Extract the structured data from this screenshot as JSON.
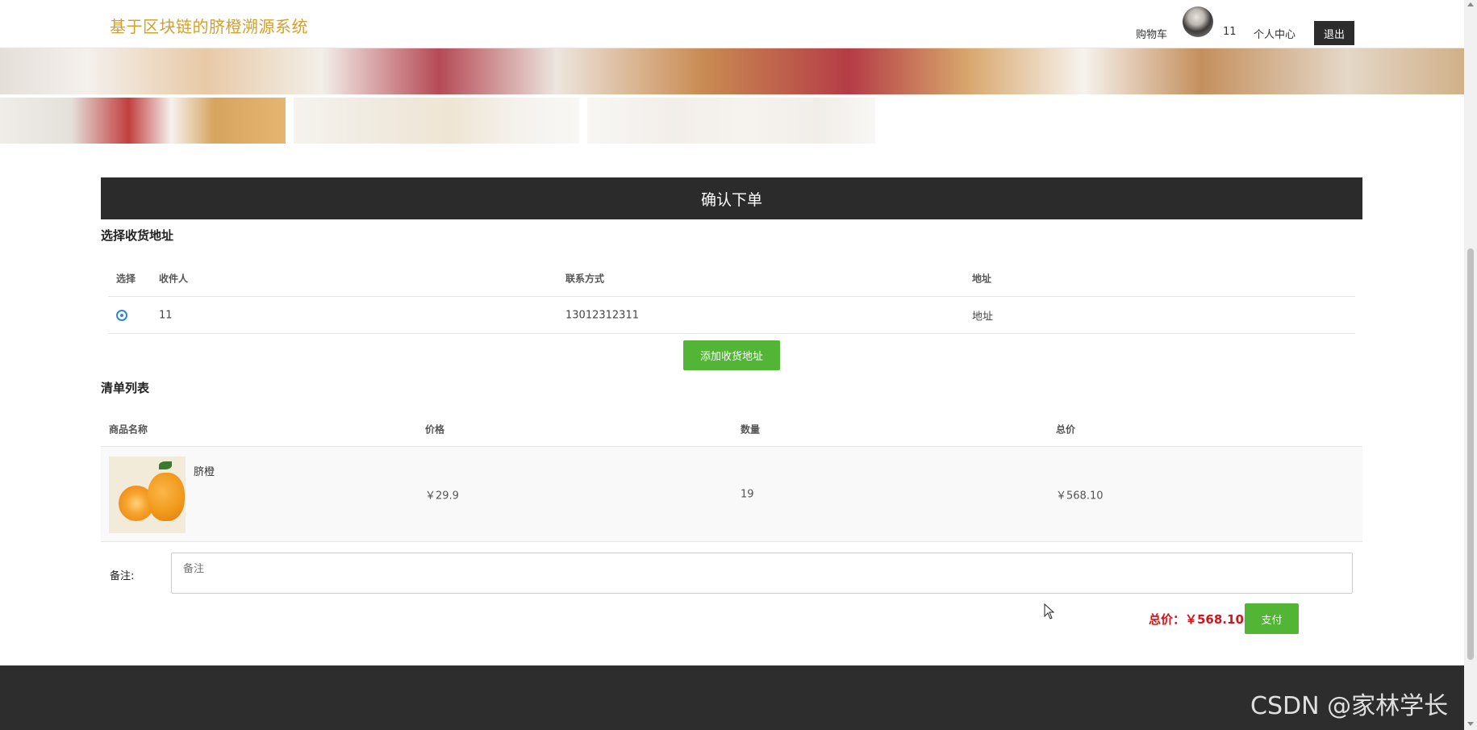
{
  "header": {
    "brand": "基于区块链的脐橙溯源系统",
    "cart": "购物车",
    "username": "11",
    "profile": "个人中心",
    "logout": "退出"
  },
  "order": {
    "title": "确认下单",
    "address_section": "选择收货地址",
    "address_columns": [
      "选择",
      "收件人",
      "联系方式",
      "地址"
    ],
    "addresses": [
      {
        "recipient": "11",
        "phone": "13012312311",
        "address": "地址",
        "selected": true
      }
    ],
    "add_address": "添加收货地址",
    "list_section": "清单列表",
    "item_columns": [
      "商品名称",
      "价格",
      "数量",
      "总价"
    ],
    "items": [
      {
        "name": "脐橙",
        "price": "￥29.9",
        "qty": "19",
        "total": "￥568.10"
      }
    ],
    "remark_label": "备注:",
    "remark_placeholder": "备注",
    "total_label": "总价：￥568.10",
    "pay": "支付"
  },
  "watermark": "CSDN @家林学长",
  "colors": {
    "brand": "#d4a02a",
    "accent_green": "#52b535",
    "price_red": "#d2151b",
    "dark": "#2b2b2b"
  }
}
